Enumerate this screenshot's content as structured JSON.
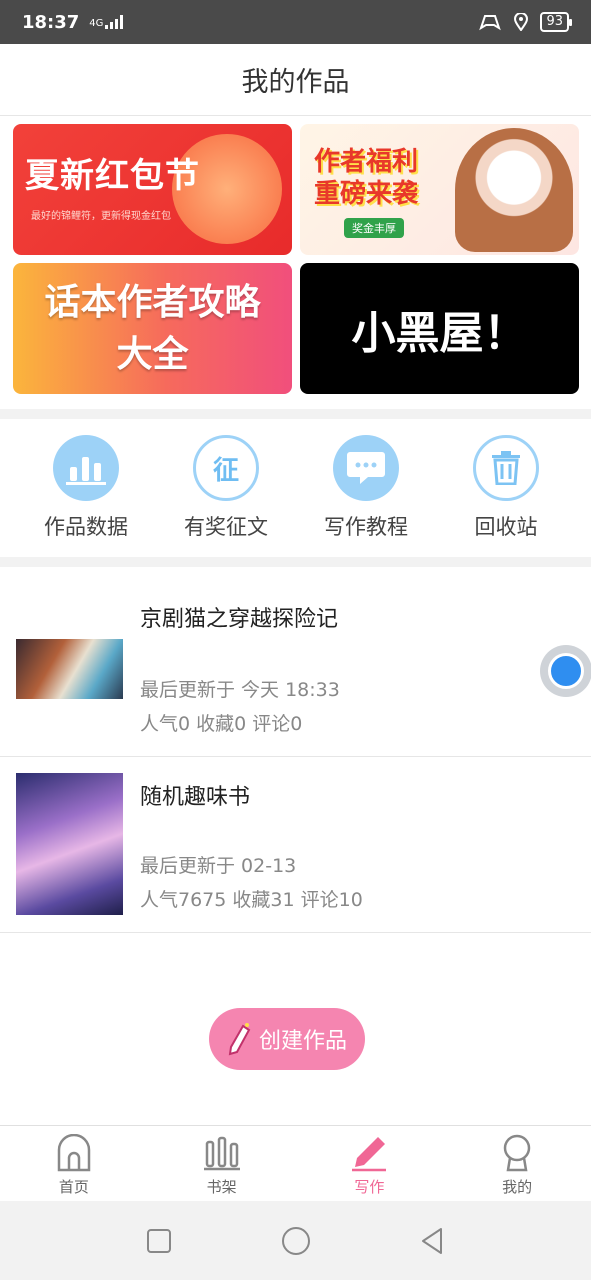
{
  "status_bar": {
    "time": "18:37",
    "network": "4G",
    "battery": "93"
  },
  "header": {
    "title": "我的作品"
  },
  "banners": [
    {
      "title": "夏新红包节",
      "subtitle": "最好的锦鲤符，更新得现金红包"
    },
    {
      "title_line1": "作者福利",
      "title_line2": "重磅来袭",
      "tag": "奖金丰厚"
    },
    {
      "title_line1": "话本作者攻略",
      "title_line2": "大全"
    },
    {
      "title": "小黑屋！"
    }
  ],
  "tools": [
    {
      "label": "作品数据",
      "icon": "bar-chart-icon"
    },
    {
      "label": "有奖征文",
      "icon": "zheng-badge-icon",
      "glyph": "征"
    },
    {
      "label": "写作教程",
      "icon": "chat-bubble-icon"
    },
    {
      "label": "回收站",
      "icon": "trash-icon"
    }
  ],
  "works": [
    {
      "title": "京剧猫之穿越探险记",
      "updated": "最后更新于 今天 18:33",
      "stats": "人气0 收藏0 评论0"
    },
    {
      "title": "随机趣味书",
      "updated": "最后更新于 02-13",
      "stats": "人气7675 收藏31 评论10"
    }
  ],
  "create_button": {
    "label": "创建作品"
  },
  "tabbar": [
    {
      "label": "首页",
      "icon": "home-icon"
    },
    {
      "label": "书架",
      "icon": "bookshelf-icon"
    },
    {
      "label": "写作",
      "icon": "pencil-icon",
      "active": true
    },
    {
      "label": "我的",
      "icon": "profile-icon"
    }
  ],
  "colors": {
    "accent": "#f06795",
    "tool_blue": "#9dd2f7",
    "create_pink": "#f585b0"
  }
}
